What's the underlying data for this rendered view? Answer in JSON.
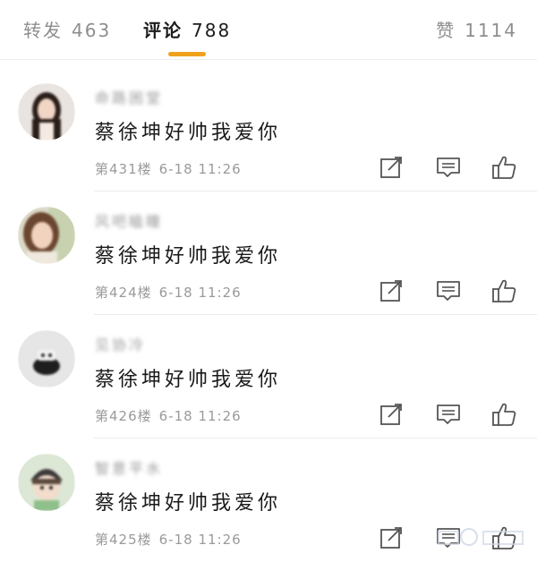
{
  "tabs": {
    "repost": {
      "label": "转发",
      "count": "463"
    },
    "comment": {
      "label": "评论",
      "count": "788"
    },
    "like": {
      "label": "赞",
      "count": "1114"
    }
  },
  "comments": [
    {
      "username": "命路困堂",
      "content": "蔡徐坤好帅我爱你",
      "floor": "第431楼",
      "time": "6-18 11:26",
      "avatar": "girl-long-hair"
    },
    {
      "username": "风吧瞌瞳",
      "content": "蔡徐坤好帅我爱你",
      "floor": "第424楼",
      "time": "6-18 11:26",
      "avatar": "girl-smiling"
    },
    {
      "username": "见协冷",
      "content": "蔡徐坤好帅我爱你",
      "floor": "第426楼",
      "time": "6-18 11:26",
      "avatar": "default-gray"
    },
    {
      "username": "智意平水",
      "content": "蔡徐坤好帅我爱你",
      "floor": "第425楼",
      "time": "6-18 11:26",
      "avatar": "cartoon-hat"
    }
  ],
  "icons": {
    "share": "share-edit-icon",
    "reply": "comment-bubble-icon",
    "like": "thumbs-up-icon"
  },
  "colors": {
    "accent": "#f0a11a",
    "muted_text": "#8e8e8e",
    "icon": "#555555"
  }
}
